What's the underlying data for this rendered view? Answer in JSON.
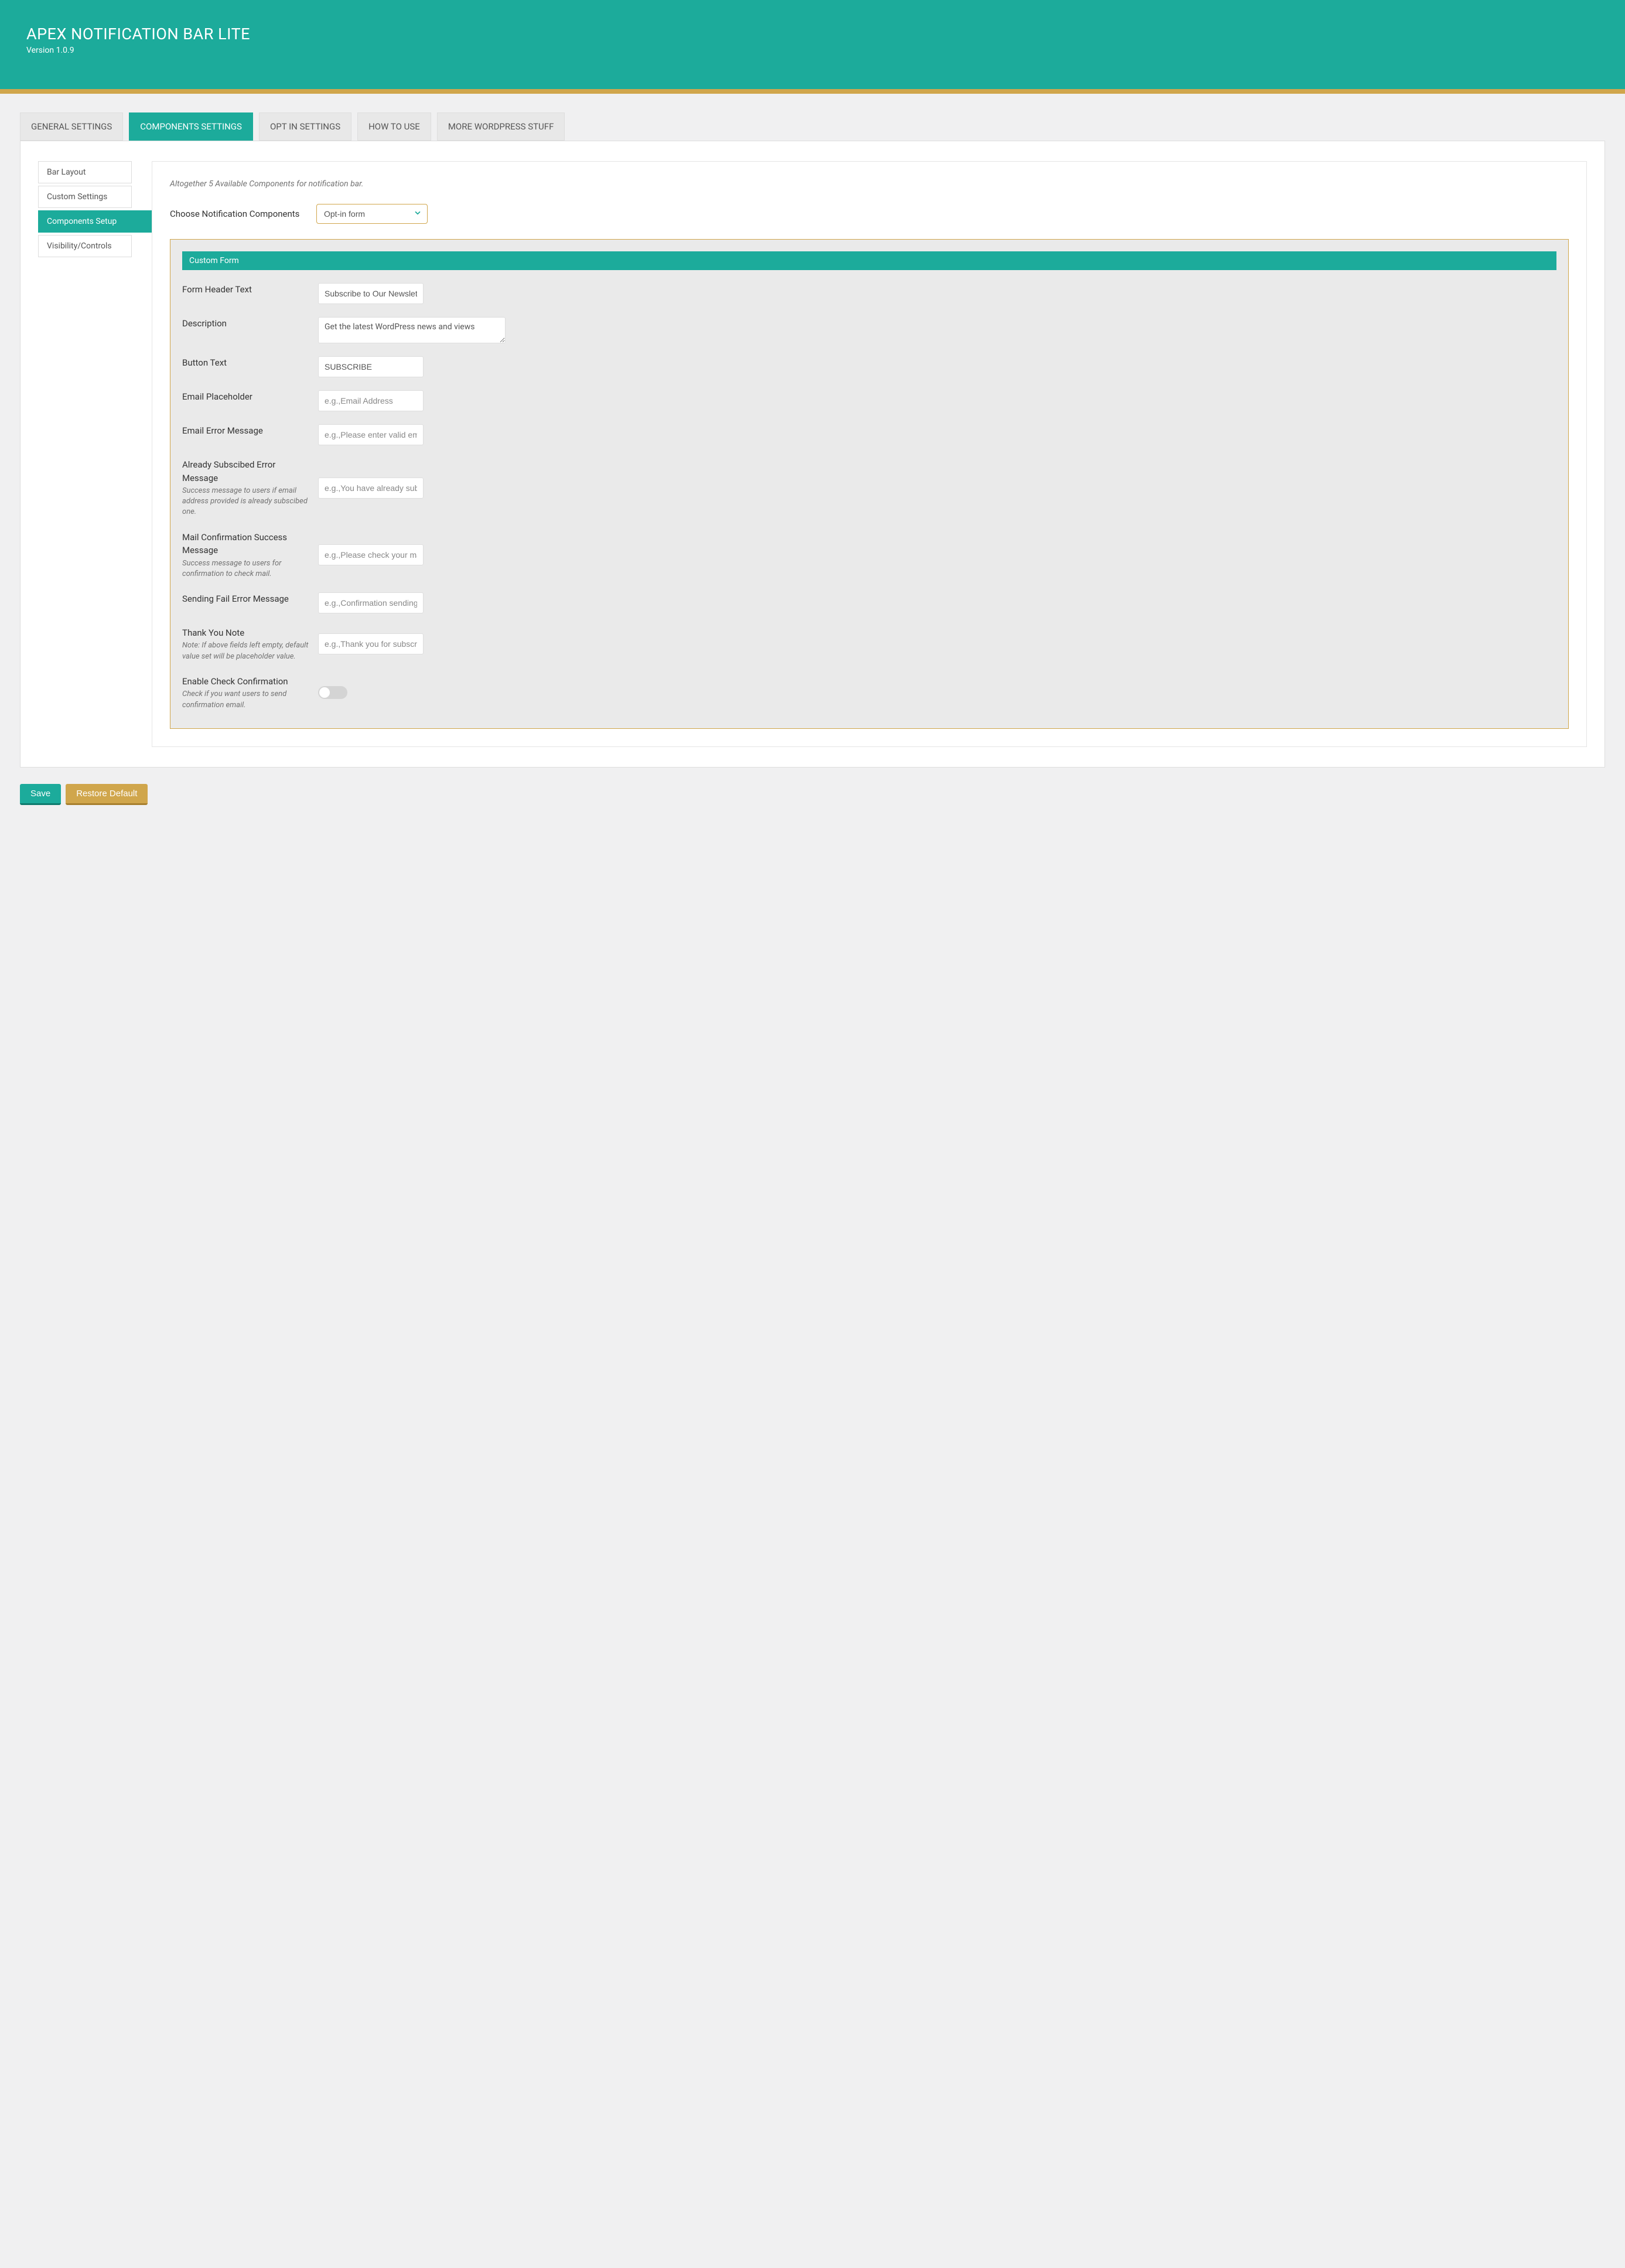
{
  "header": {
    "title": "APEX NOTIFICATION BAR LITE",
    "version": "Version 1.0.9"
  },
  "tabs": [
    {
      "label": "GENERAL SETTINGS",
      "active": false
    },
    {
      "label": "COMPONENTS SETTINGS",
      "active": true
    },
    {
      "label": "OPT IN SETTINGS",
      "active": false
    },
    {
      "label": "HOW TO USE",
      "active": false
    },
    {
      "label": "MORE WORDPRESS STUFF",
      "active": false
    }
  ],
  "sidebar": {
    "items": [
      {
        "label": "Bar Layout",
        "active": false
      },
      {
        "label": "Custom Settings",
        "active": false
      },
      {
        "label": "Components Setup",
        "active": true
      },
      {
        "label": "Visibility/Controls",
        "active": false
      }
    ]
  },
  "content": {
    "intro": "Altogether 5 Available Components for notification bar.",
    "select_label": "Choose Notification Components",
    "select_value": "Opt-in form"
  },
  "form": {
    "section_header": "Custom Form",
    "fields": {
      "form_header_text": {
        "label": "Form Header Text",
        "value": "Subscribe to Our Newsletter"
      },
      "description": {
        "label": "Description",
        "value": "Get the latest WordPress news and views"
      },
      "button_text": {
        "label": "Button Text",
        "value": "SUBSCRIBE"
      },
      "email_placeholder": {
        "label": "Email Placeholder",
        "placeholder": "e.g.,Email Address"
      },
      "email_error": {
        "label": "Email Error Message",
        "placeholder": "e.g.,Please enter valid email"
      },
      "already_subscribed": {
        "label": "Already Subscibed Error Message",
        "help": "Success message to users if email address provided is already subscibed one.",
        "placeholder": "e.g.,You have already subscribed"
      },
      "mail_confirmation": {
        "label": "Mail Confirmation Success Message",
        "help": "Success message to users for confirmation to check mail.",
        "placeholder": "e.g.,Please check your mail"
      },
      "sending_fail": {
        "label": "Sending Fail Error Message",
        "placeholder": "e.g.,Confirmation sending failed"
      },
      "thank_you": {
        "label": "Thank You Note",
        "help": "Note: If above fields left empty, default value set will be placeholder value.",
        "placeholder": "e.g.,Thank you for subscribing"
      },
      "enable_check": {
        "label": "Enable Check Confirmation",
        "help": "Check if you want users to send confirmation email."
      }
    }
  },
  "buttons": {
    "save": "Save",
    "restore": "Restore Default"
  }
}
